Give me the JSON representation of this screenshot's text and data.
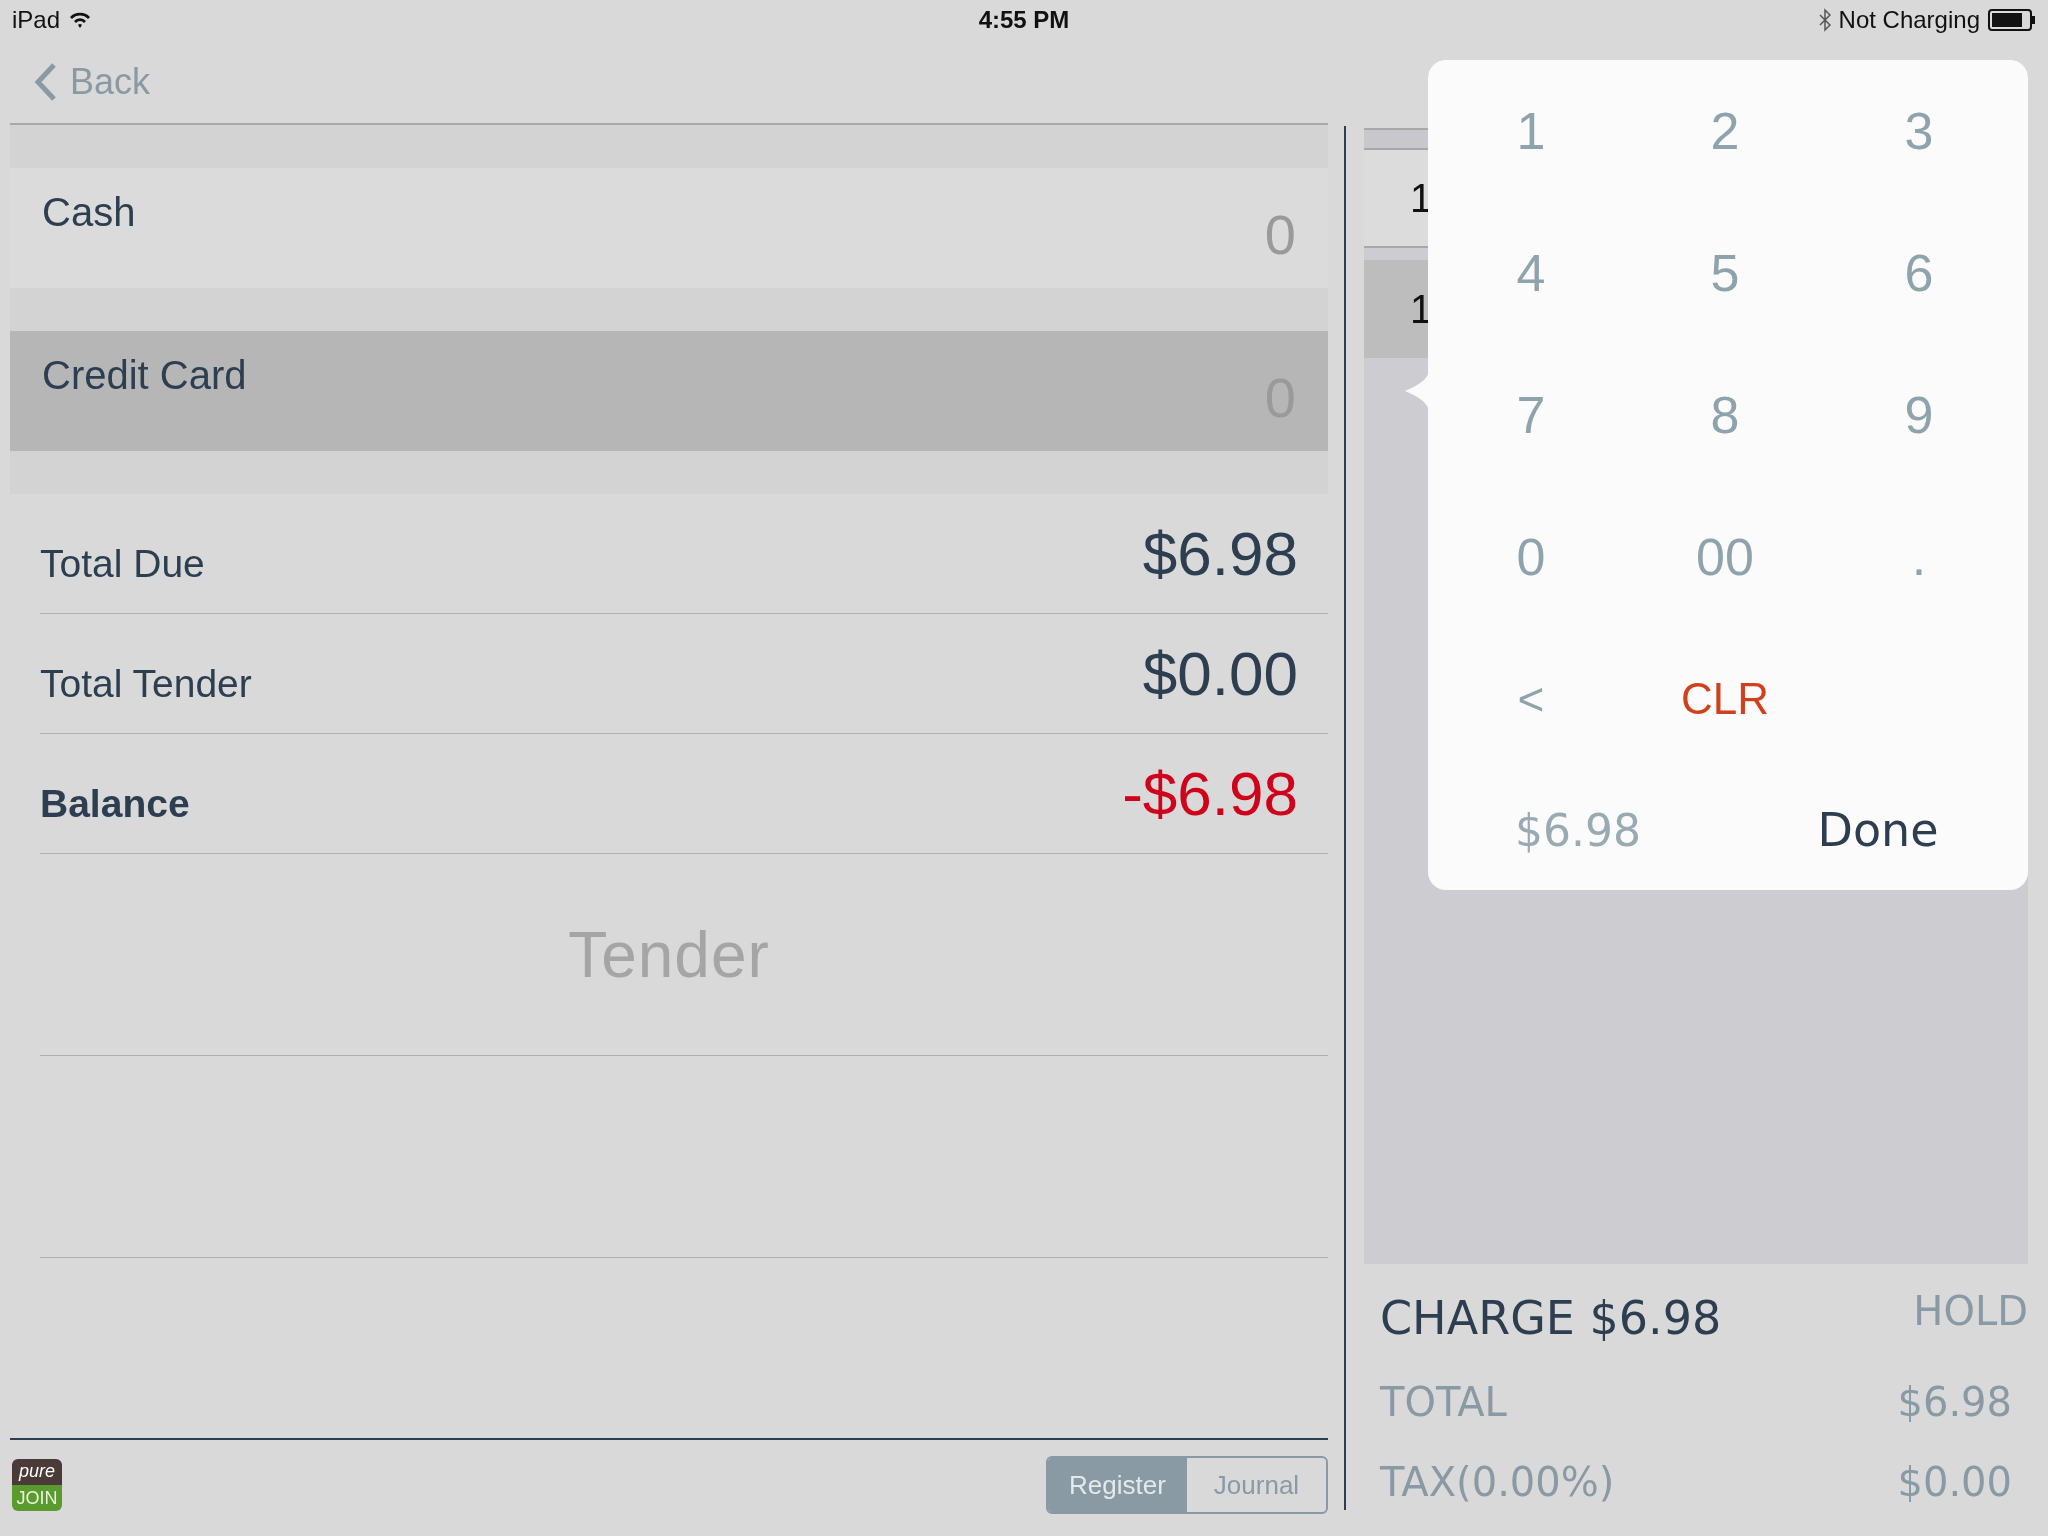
{
  "status_bar": {
    "device": "iPad",
    "time": "4:55 PM",
    "charging": "Not Charging"
  },
  "nav": {
    "back": "Back"
  },
  "tender_methods": [
    {
      "label": "Cash",
      "placeholder": "0",
      "selected": false
    },
    {
      "label": "Credit Card",
      "placeholder": "0",
      "selected": true
    }
  ],
  "summary": [
    {
      "label": "Total Due",
      "value": "$6.98",
      "kind": "normal"
    },
    {
      "label": "Total Tender",
      "value": "$0.00",
      "kind": "normal"
    },
    {
      "label": "Balance",
      "value": "-$6.98",
      "kind": "balance"
    }
  ],
  "tender_button": "Tender",
  "footer": {
    "logo_top": "pure",
    "logo_bottom": "JOIN",
    "segments": [
      {
        "label": "Register",
        "selected": true
      },
      {
        "label": "Journal",
        "selected": false
      }
    ]
  },
  "order_list": {
    "rows": [
      {
        "column_1": "1",
        "selected": false
      },
      {
        "column_1": "1",
        "selected": true
      }
    ]
  },
  "keypad": {
    "keys": [
      {
        "label": "1",
        "kind": "digit"
      },
      {
        "label": "2",
        "kind": "digit"
      },
      {
        "label": "3",
        "kind": "digit"
      },
      {
        "label": "4",
        "kind": "digit"
      },
      {
        "label": "5",
        "kind": "digit"
      },
      {
        "label": "6",
        "kind": "digit"
      },
      {
        "label": "7",
        "kind": "digit"
      },
      {
        "label": "8",
        "kind": "digit"
      },
      {
        "label": "9",
        "kind": "digit"
      },
      {
        "label": "0",
        "kind": "digit"
      },
      {
        "label": "00",
        "kind": "digit"
      },
      {
        "label": ".",
        "kind": "digit"
      },
      {
        "label": "<",
        "kind": "backspace"
      },
      {
        "label": "CLR",
        "kind": "clear"
      }
    ],
    "amount": "$6.98",
    "done": "Done"
  },
  "charge": {
    "button": "CHARGE $6.98",
    "hold": "HOLD",
    "lines": [
      {
        "label": "TOTAL",
        "value": "$6.98"
      },
      {
        "label": "TAX(0.00%)",
        "value": "$0.00"
      }
    ]
  }
}
